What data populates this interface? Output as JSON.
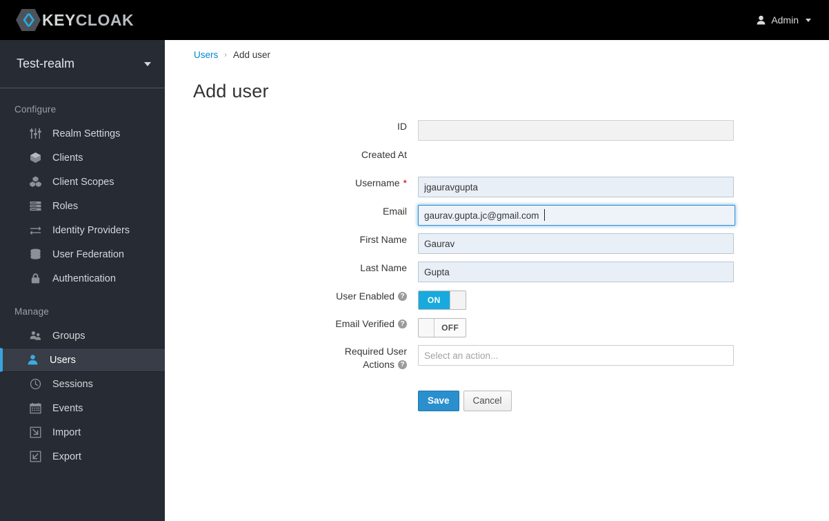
{
  "masthead": {
    "brand_key": "KEY",
    "brand_cloak": "CLOAK",
    "logo_icon": "keycloak-hexagon-logo",
    "user_icon": "user-icon",
    "user_label": "Admin",
    "caret_icon": "chevron-down-icon"
  },
  "sidebar": {
    "realm": {
      "name": "Test-realm",
      "caret_icon": "chevron-down-icon"
    },
    "sections": [
      {
        "title": "Configure",
        "items": [
          {
            "label": "Realm Settings",
            "icon": "sliders-icon",
            "active": false
          },
          {
            "label": "Clients",
            "icon": "cube-icon",
            "active": false
          },
          {
            "label": "Client Scopes",
            "icon": "cubes-icon",
            "active": false
          },
          {
            "label": "Roles",
            "icon": "list-rows-icon",
            "active": false
          },
          {
            "label": "Identity Providers",
            "icon": "exchange-arrows-icon",
            "active": false
          },
          {
            "label": "User Federation",
            "icon": "database-icon",
            "active": false
          },
          {
            "label": "Authentication",
            "icon": "lock-icon",
            "active": false
          }
        ]
      },
      {
        "title": "Manage",
        "items": [
          {
            "label": "Groups",
            "icon": "users-group-icon",
            "active": false
          },
          {
            "label": "Users",
            "icon": "user-icon",
            "active": true
          },
          {
            "label": "Sessions",
            "icon": "clock-icon",
            "active": false
          },
          {
            "label": "Events",
            "icon": "calendar-icon",
            "active": false
          },
          {
            "label": "Import",
            "icon": "import-arrow-icon",
            "active": false
          },
          {
            "label": "Export",
            "icon": "export-arrow-icon",
            "active": false
          }
        ]
      }
    ]
  },
  "breadcrumb": {
    "parent": "Users",
    "separator": "›",
    "current": "Add user"
  },
  "page": {
    "title": "Add user"
  },
  "form": {
    "fields": {
      "id": {
        "label": "ID",
        "value": "",
        "state": "disabled"
      },
      "created_at": {
        "label": "Created At",
        "value": ""
      },
      "username": {
        "label": "Username",
        "value": "jgauravgupta",
        "required_marker": "*"
      },
      "email": {
        "label": "Email",
        "value": "gaurav.gupta.jc@gmail.com",
        "state": "focused"
      },
      "first_name": {
        "label": "First Name",
        "value": "Gaurav"
      },
      "last_name": {
        "label": "Last Name",
        "value": "Gupta"
      },
      "user_enabled": {
        "label": "User Enabled",
        "value": "ON",
        "help_icon": "help-circle-icon"
      },
      "email_verified": {
        "label": "Email Verified",
        "value": "OFF",
        "help_icon": "help-circle-icon"
      },
      "required_user_actions": {
        "label_line1": "Required User",
        "label_line2": "Actions",
        "placeholder": "Select an action...",
        "value": "",
        "help_icon": "help-circle-icon"
      }
    },
    "buttons": {
      "save": "Save",
      "cancel": "Cancel"
    }
  },
  "colors": {
    "masthead_bg": "#000000",
    "sidebar_bg": "#272c34",
    "sidebar_active_bg": "#383d47",
    "accent_blue": "#39a5dc",
    "link_blue": "#0088ce",
    "primary_button": "#2b8fce",
    "toggle_on": "#18aade",
    "required_red": "#cc0000",
    "input_bg": "#e9eff7"
  }
}
